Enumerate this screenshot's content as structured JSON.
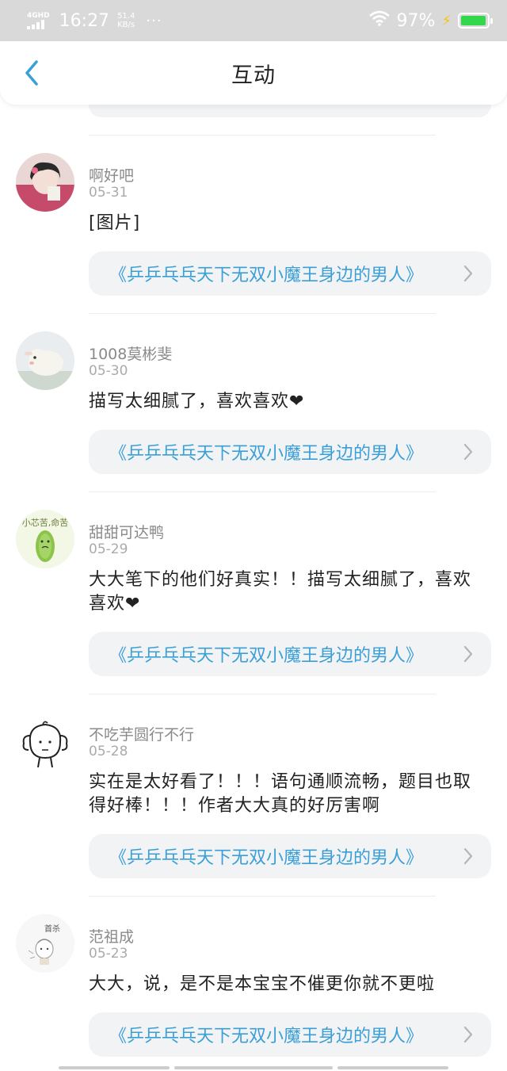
{
  "status_bar": {
    "network": "4GHD",
    "time": "16:27",
    "speed_value": "51.4",
    "speed_unit": "KB/s",
    "dots": "···",
    "battery_percent": "97%",
    "battery_level": 0.97,
    "battery_color": "#32d74b"
  },
  "header": {
    "title": "互动",
    "back_icon": "chevron-left-icon",
    "accent_color": "#3a9fd6"
  },
  "comments": [
    {
      "name": "啊好吧",
      "date": "05-31",
      "text": "[图片]",
      "book_title": "《乒乒乓乓天下无双小魔王身边的男人》",
      "avatar_icon": "user-avatar-photo-icon"
    },
    {
      "name": "1008莫彬斐",
      "date": "05-30",
      "text": "描写太细腻了，喜欢喜欢❤",
      "book_title": "《乒乒乓乓天下无双小魔王身边的男人》",
      "avatar_icon": "sheep-avatar-icon"
    },
    {
      "name": "甜甜可达鸭",
      "date": "05-29",
      "text": "大大笔下的他们好真实！！描写太细腻了，喜欢喜欢❤",
      "book_title": "《乒乒乓乓天下无双小魔王身边的男人》",
      "avatar_icon": "cucumber-avatar-icon",
      "avatar_text": "小芯苦,命苦"
    },
    {
      "name": "不吃芋圆行不行",
      "date": "05-28",
      "text": "实在是太好看了！！！语句通顺流畅，题目也取得好棒！！！作者大大真的好厉害啊",
      "book_title": "《乒乒乓乓天下无双小魔王身边的男人》",
      "avatar_icon": "doodle-face-avatar-icon"
    },
    {
      "name": "范祖成",
      "date": "05-23",
      "text": "大大，说，是不是本宝宝不催更你就不更啦",
      "book_title": "《乒乒乓乓天下无双小魔王身边的男人》",
      "avatar_icon": "sketch-avatar-icon",
      "avatar_text": "首杀"
    }
  ]
}
